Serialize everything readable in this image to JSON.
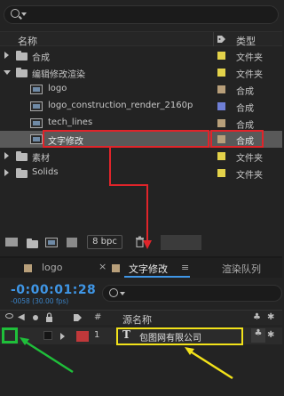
{
  "project": {
    "search_placeholder": "",
    "columns": {
      "name": "名称",
      "type": "类型"
    },
    "items": [
      {
        "label": "合成",
        "type": "文件夹",
        "kind": "folder",
        "expanded": false,
        "color": "#e3d24a"
      },
      {
        "label": "编辑修改渲染",
        "type": "文件夹",
        "kind": "folder",
        "expanded": true,
        "color": "#e3d24a"
      },
      {
        "label": "logo",
        "type": "合成",
        "kind": "comp",
        "color": "#b89f7a"
      },
      {
        "label": "logo_construction_render_2160p",
        "type": "合成",
        "kind": "comp",
        "color": "#6f7fd6"
      },
      {
        "label": "tech_lines",
        "type": "合成",
        "kind": "comp",
        "color": "#b89f7a"
      },
      {
        "label": "文字修改",
        "type": "合成",
        "kind": "comp",
        "color": "#b89f7a",
        "selected": true
      },
      {
        "label": "素材",
        "type": "文件夹",
        "kind": "folder",
        "expanded": false,
        "color": "#e3d24a"
      },
      {
        "label": "Solids",
        "type": "文件夹",
        "kind": "folder",
        "expanded": false,
        "color": "#e3d24a"
      }
    ],
    "bit_depth": "8 bpc"
  },
  "timeline": {
    "tabs": [
      {
        "label": "logo",
        "active": false
      },
      {
        "label": "文字修改",
        "active": true
      },
      {
        "label": "渲染队列",
        "active": false
      }
    ],
    "timecode": "-0:00:01:28",
    "frame_info": "-0058 (30.00 fps)",
    "columns": {
      "index": "#",
      "source_name": "源名称"
    },
    "layer": {
      "index": "1",
      "type_glyph": "T",
      "name": "包图网有限公司",
      "label_color": "#c0383a"
    }
  },
  "colors": {
    "highlight_red": "#e0242a",
    "highlight_yellow": "#f2e21a",
    "highlight_green": "#1fbf3a",
    "timecode": "#3f96e6"
  }
}
